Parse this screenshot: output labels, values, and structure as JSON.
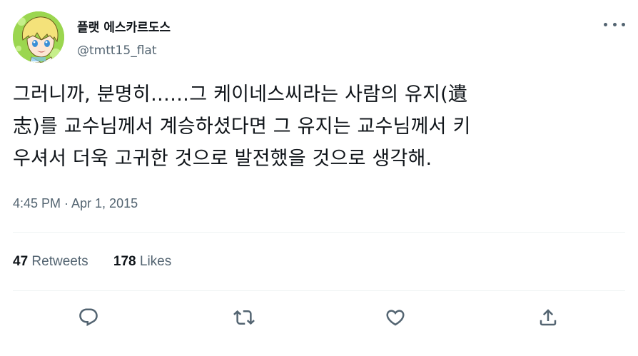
{
  "user": {
    "display_name": "플랫 에스카르도스",
    "handle": "@tmtt15_flat",
    "avatar_icon": "anime-avatar"
  },
  "tweet": {
    "lines": [
      "그러니까, 분명히……그 케이네스씨라는 사람의 유지(遺",
      "志)를 교수님께서 계승하셨다면 그 유지는 교수님께서 키",
      "우셔서 더욱 고귀한 것으로 발전했을 것으로 생각해."
    ],
    "timestamp": "4:45 PM · Apr 1, 2015"
  },
  "stats": {
    "retweets_count": "47",
    "retweets_label": "Retweets",
    "likes_count": "178",
    "likes_label": "Likes"
  },
  "actions": {
    "reply_icon": "reply-icon",
    "retweet_icon": "retweet-icon",
    "like_icon": "like-icon",
    "share_icon": "share-icon"
  },
  "colors": {
    "text_primary": "#0f1419",
    "text_secondary": "#536471",
    "divider": "#eff3f4",
    "avatar_bg": "#8fd14a"
  }
}
